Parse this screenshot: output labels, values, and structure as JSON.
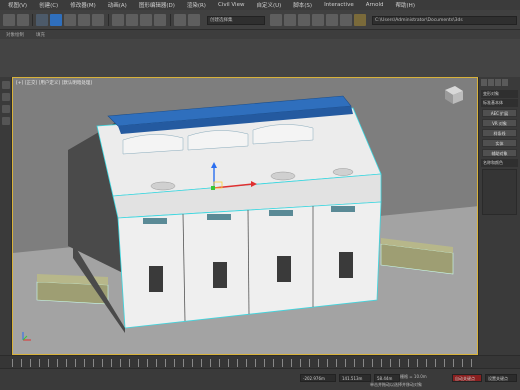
{
  "menu": [
    "视图(V)",
    "创建(C)",
    "修改器(M)",
    "动画(A)",
    "图形编辑器(D)",
    "渲染(R)",
    "Civil View",
    "自定义(U)",
    "脚本(S)",
    "Interactive",
    "Arnold",
    "帮助(H)"
  ],
  "toolbar": {
    "selection_set_placeholder": "创建选择集",
    "path": "C:\\Users\\Administrator\\Documents\\3ds",
    "view_dropdown": "视图"
  },
  "ribbon": [
    "对象绘制",
    "填充"
  ],
  "viewport": {
    "label": "[+] [正交] [用户定义] [默认明暗处理]"
  },
  "command_panel": {
    "header": "变形对象",
    "section": "标准基本体",
    "buttons": [
      "AEC 扩展",
      "VR 对象",
      "样条线",
      "实体",
      "辅助对象"
    ],
    "section2": "名称和颜色"
  },
  "status": {
    "x": "-202.976m",
    "y": "141.513m",
    "z": "58.44m",
    "grid": "栅格 = 10.0m",
    "prompt": "单击并拖动以选择并移动对象",
    "add_time_tag": "添加时间标记",
    "auto_key": "自动关键点",
    "set_key": "设置关键点"
  },
  "timeline": {
    "frame": "0 / 100"
  },
  "colors": {
    "viewport_bg": "#7e7e7e",
    "device_body": "#e6e6e6",
    "blue_bar": "#2f6fbd",
    "selection_outline": "#3cd7e0",
    "rail": "#9e9e73",
    "active_border": "#d8b23a"
  }
}
